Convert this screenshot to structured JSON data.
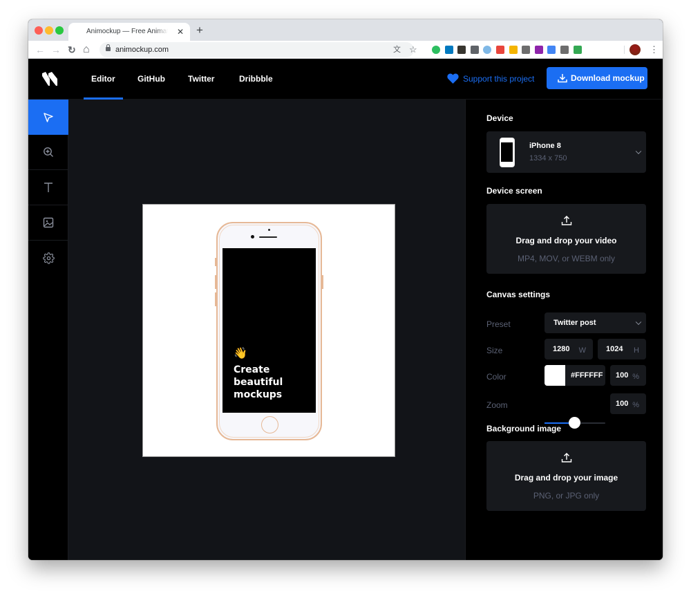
{
  "browser": {
    "tab_title": "Animockup — Free Animated Mockups",
    "tab_close": "✕",
    "new_tab": "+",
    "url": "animockup.com",
    "nav": {
      "back": "←",
      "forward": "→",
      "reload": "↻",
      "home": "⌂"
    },
    "omnibox_icons": {
      "translate": "文",
      "star": "☆"
    },
    "extensions": [
      {
        "name": "evernote-icon",
        "color": "#2dbe60"
      },
      {
        "name": "trello-icon",
        "color": "#0079bf"
      },
      {
        "name": "notion-icon",
        "color": "#37352f"
      },
      {
        "name": "mail-icon",
        "color": "#5f6368"
      },
      {
        "name": "circle-extension-icon",
        "color": "#7fb8e6"
      },
      {
        "name": "feather-icon",
        "color": "#e8453c"
      },
      {
        "name": "more-extension-icon",
        "color": "#f4b400"
      },
      {
        "name": "qr-code-icon",
        "color": "#6d6d6d"
      },
      {
        "name": "xp-icon",
        "color": "#8e24aa"
      },
      {
        "name": "google-translate-icon",
        "color": "#4285f4"
      },
      {
        "name": "screenshot-extension-icon",
        "color": "#6d6d6d"
      },
      {
        "name": "shield-check-icon",
        "color": "#34a853"
      }
    ],
    "menu": "⋮"
  },
  "header": {
    "nav": [
      {
        "label": "Editor",
        "active": true
      },
      {
        "label": "GitHub",
        "active": false
      },
      {
        "label": "Twitter",
        "active": false
      },
      {
        "label": "Dribbble",
        "active": false
      }
    ],
    "support_label": "Support this project",
    "download_label": "Download mockup",
    "accent": "#1b6ef3"
  },
  "tools": [
    {
      "name": "select-tool",
      "icon": "pointer-icon",
      "active": true
    },
    {
      "name": "zoom-tool",
      "icon": "zoom-in-icon",
      "active": false
    },
    {
      "name": "text-tool",
      "icon": "text-icon",
      "active": false
    },
    {
      "name": "image-tool",
      "icon": "image-icon",
      "active": false
    },
    {
      "name": "settings-tool",
      "icon": "gear-icon",
      "active": false
    }
  ],
  "canvas": {
    "emoji": "👋",
    "screen_lines": [
      "Create",
      "beautiful",
      "mockups"
    ]
  },
  "panel": {
    "device": {
      "title": "Device",
      "name": "iPhone 8",
      "resolution": "1334 x 750"
    },
    "device_screen": {
      "title": "Device screen",
      "drop_title": "Drag and drop your video",
      "drop_sub": "MP4, MOV, or WEBM only"
    },
    "canvas_settings": {
      "title": "Canvas settings",
      "preset_label": "Preset",
      "preset_value": "Twitter post",
      "size_label": "Size",
      "width": "1280",
      "width_unit": "W",
      "height": "1024",
      "height_unit": "H",
      "color_label": "Color",
      "color_hex": "#FFFFFF",
      "color_opacity": "100",
      "percent_unit": "%",
      "zoom_label": "Zoom",
      "zoom_value": "100",
      "zoom_slider_fraction": 0.5
    },
    "background_image": {
      "title": "Background image",
      "drop_title": "Drag and drop your image",
      "drop_sub": "PNG, or JPG only"
    }
  }
}
